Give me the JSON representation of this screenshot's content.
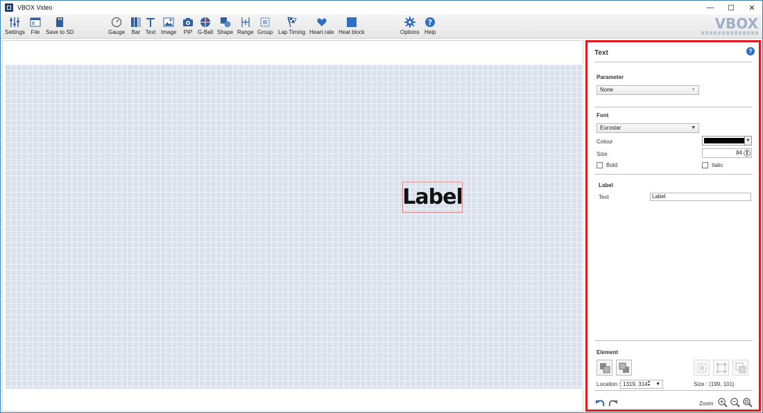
{
  "window": {
    "title": "VBOX Video",
    "controls": {
      "minimize": "—",
      "maximize": "☐",
      "close": "✕"
    }
  },
  "toolbar": {
    "items": [
      {
        "id": "settings",
        "label": "Settings",
        "icon": "sliders-icon"
      },
      {
        "id": "file",
        "label": "File",
        "icon": "file-window-icon"
      },
      {
        "id": "save-to-sd",
        "label": "Save to SD",
        "icon": "sd-card-icon"
      },
      {
        "id": "gauge",
        "label": "Gauge",
        "icon": "gauge-icon"
      },
      {
        "id": "bar",
        "label": "Bar",
        "icon": "bar-icon"
      },
      {
        "id": "text",
        "label": "Text",
        "icon": "text-icon"
      },
      {
        "id": "image",
        "label": "Image",
        "icon": "image-icon"
      },
      {
        "id": "pip",
        "label": "PiP",
        "icon": "camera-icon"
      },
      {
        "id": "g-ball",
        "label": "G-Ball",
        "icon": "g-ball-icon"
      },
      {
        "id": "shape",
        "label": "Shape",
        "icon": "shape-icon"
      },
      {
        "id": "range",
        "label": "Range",
        "icon": "range-icon"
      },
      {
        "id": "group",
        "label": "Group",
        "icon": "group-icon"
      },
      {
        "id": "lap-timing",
        "label": "Lap Timing",
        "icon": "checkered-flag-icon"
      },
      {
        "id": "heart-rate",
        "label": "Heart rate",
        "icon": "heart-icon"
      },
      {
        "id": "heat-block",
        "label": "Heat block",
        "icon": "heat-block-icon"
      },
      {
        "id": "options",
        "label": "Options",
        "icon": "gear-icon"
      },
      {
        "id": "help",
        "label": "Help",
        "icon": "help-icon"
      }
    ],
    "logo": "VBOX"
  },
  "canvas": {
    "element_text": "Label"
  },
  "panel": {
    "title": "Text",
    "help_icon": "?",
    "parameter": {
      "heading": "Parameter",
      "value": "None"
    },
    "font": {
      "heading": "Font",
      "family": "Eurostar",
      "colour_label": "Colour",
      "colour_value": "#000000",
      "size_label": "Size",
      "size_value": "84",
      "bold_label": "Bold",
      "italic_label": "Italic"
    },
    "label": {
      "heading": "Label",
      "text_label": "Text",
      "text_value": "Label"
    },
    "element": {
      "heading": "Element",
      "location_label": "Location :",
      "location_value": "1319, 314",
      "size_text": "Size : (199, 101)"
    },
    "zoom_label": "Zoom"
  }
}
